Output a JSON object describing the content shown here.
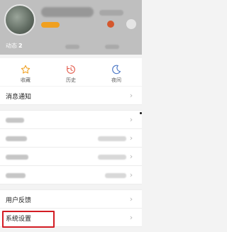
{
  "profile": {
    "stats": [
      {
        "label": "动态",
        "value": "2"
      }
    ]
  },
  "quick_actions": [
    {
      "label": "收藏",
      "icon": "star-icon"
    },
    {
      "label": "历史",
      "icon": "history-clock-icon"
    },
    {
      "label": "夜间",
      "icon": "moon-icon"
    }
  ],
  "list": {
    "message_notifications": "消息通知",
    "feedback": "用户反馈",
    "system_settings": "系统设置"
  },
  "colors": {
    "highlight": "#d31d24",
    "accent_orange": "#f0a020"
  }
}
